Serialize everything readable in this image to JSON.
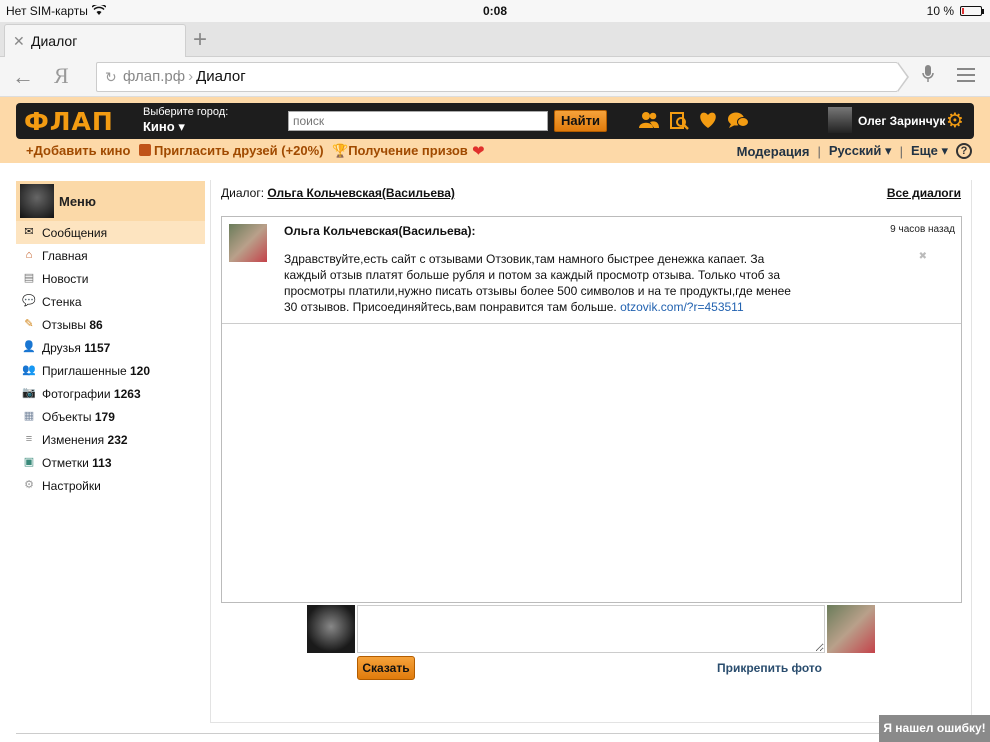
{
  "status_bar": {
    "carrier": "Нет SIM-карты",
    "time": "0:08",
    "battery": "10 %",
    "battery_level": 0.1
  },
  "browser": {
    "tab_title": "Диалог",
    "url_domain": "флап.рф",
    "url_page": "Диалог",
    "yandex_glyph": "Я"
  },
  "site": {
    "logo": "ФЛАП",
    "city_label": "Выберите город:",
    "city_value": "Кино ▾",
    "search_placeholder": "поиск",
    "search_button": "Найти",
    "user_name": "Олег Заринчук",
    "sub_add": "+Добавить кино",
    "sub_invite": "Пригласить друзей (+20%)",
    "sub_prizes": "Получение призов",
    "moderation": "Модерация",
    "language": "Русский",
    "more": "Еще",
    "help": "?"
  },
  "sidebar": {
    "title": "Меню",
    "items": [
      {
        "label": "Сообщения",
        "count": "",
        "icon": "envelope-icon"
      },
      {
        "label": "Главная",
        "count": "",
        "icon": "home-icon"
      },
      {
        "label": "Новости",
        "count": "",
        "icon": "news-icon"
      },
      {
        "label": "Стенка",
        "count": "",
        "icon": "speech-bubble-icon"
      },
      {
        "label": "Отзывы",
        "count": "86",
        "icon": "reviews-icon"
      },
      {
        "label": "Друзья",
        "count": "1157",
        "icon": "person-icon"
      },
      {
        "label": "Приглашенные",
        "count": "120",
        "icon": "invited-icon"
      },
      {
        "label": "Фотографии",
        "count": "1263",
        "icon": "camera-icon"
      },
      {
        "label": "Объекты",
        "count": "179",
        "icon": "building-icon"
      },
      {
        "label": "Изменения",
        "count": "232",
        "icon": "changes-icon"
      },
      {
        "label": "Отметки",
        "count": "113",
        "icon": "map-icon"
      },
      {
        "label": "Настройки",
        "count": "",
        "icon": "settings-icon"
      }
    ]
  },
  "dialog": {
    "label": "Диалог:",
    "partner": "Ольга Кольчевская(Васильева)",
    "all_dialogs": "Все диалоги",
    "message": {
      "author": "Ольга Кольчевская(Васильева):",
      "time": "9 часов назад",
      "delete": "✖",
      "text": "Здравствуйте,есть сайт с отзывами Отзовик,там намного быстрее денежка капает. За каждый отзыв платят больше рубля и потом за каждый просмотр отзыва. Только чтоб за просмотры платили,нужно писать отзывы более 500 символов и на те продукты,где менее 30 отзывов. Присоединяйтесь,вам понравится там больше.",
      "link": "otzovik.com/?r=453511"
    },
    "say_button": "Сказать",
    "attach_photo": "Прикрепить фото"
  },
  "bug_button": "Я нашел ошибку!",
  "colors": {
    "accent": "#f39c12",
    "header_bg": "#fdd9a8",
    "bar_bg": "#1d1d1d",
    "link": "#2262b0"
  }
}
